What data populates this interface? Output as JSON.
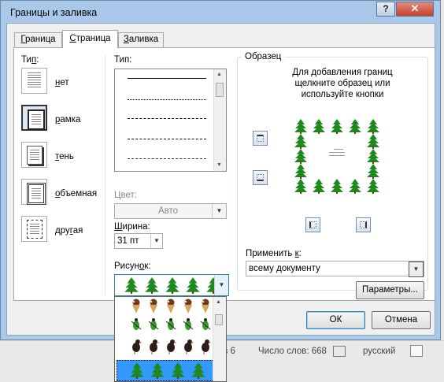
{
  "dialog": {
    "title": "Границы и заливка",
    "help_label": "?",
    "close_label": "✕",
    "tabs": [
      {
        "label": "Граница",
        "accel": "Г"
      },
      {
        "label": "Страница",
        "accel": "С"
      },
      {
        "label": "Заливка",
        "accel": "З"
      }
    ]
  },
  "settings": {
    "header_pre": "Ти",
    "header_accel": "п",
    "header_post": ":",
    "items": [
      {
        "pre": "",
        "accel": "н",
        "post": "ет"
      },
      {
        "pre": "",
        "accel": "р",
        "post": "амка"
      },
      {
        "pre": "",
        "accel": "т",
        "post": "ень"
      },
      {
        "pre": "",
        "accel": "о",
        "post": "бъемная"
      },
      {
        "pre": "дру",
        "accel": "г",
        "post": "ая"
      }
    ]
  },
  "style": {
    "header_pre": "Тип",
    "header_accel": "",
    "header_post": ":",
    "color_label": "Цвет:",
    "color_value": "Авто",
    "width_label_pre": "",
    "width_label_accel": "Ш",
    "width_label_post": "ирина:",
    "width_value": "31 пт",
    "art_label_pre": "Рисун",
    "art_label_accel": "о",
    "art_label_post": "к:"
  },
  "preview": {
    "group_label": "Образец",
    "hint": "Для добавления границ щелкните образец или используйте кнопки",
    "apply_label_pre": "Применить ",
    "apply_label_accel": "к",
    "apply_label_post": ":",
    "apply_value": "всему документу",
    "options_button": "Параметры..."
  },
  "buttons": {
    "ok": "ОК",
    "cancel": "Отмена"
  },
  "statusbar": {
    "page_fragment": "з 6",
    "word_count": "Число слов: 668",
    "language": "русский"
  },
  "colors": {
    "tree_green": "#1e8a1e",
    "selection_blue": "#3399ff",
    "title_bg": "#aac9ea"
  }
}
